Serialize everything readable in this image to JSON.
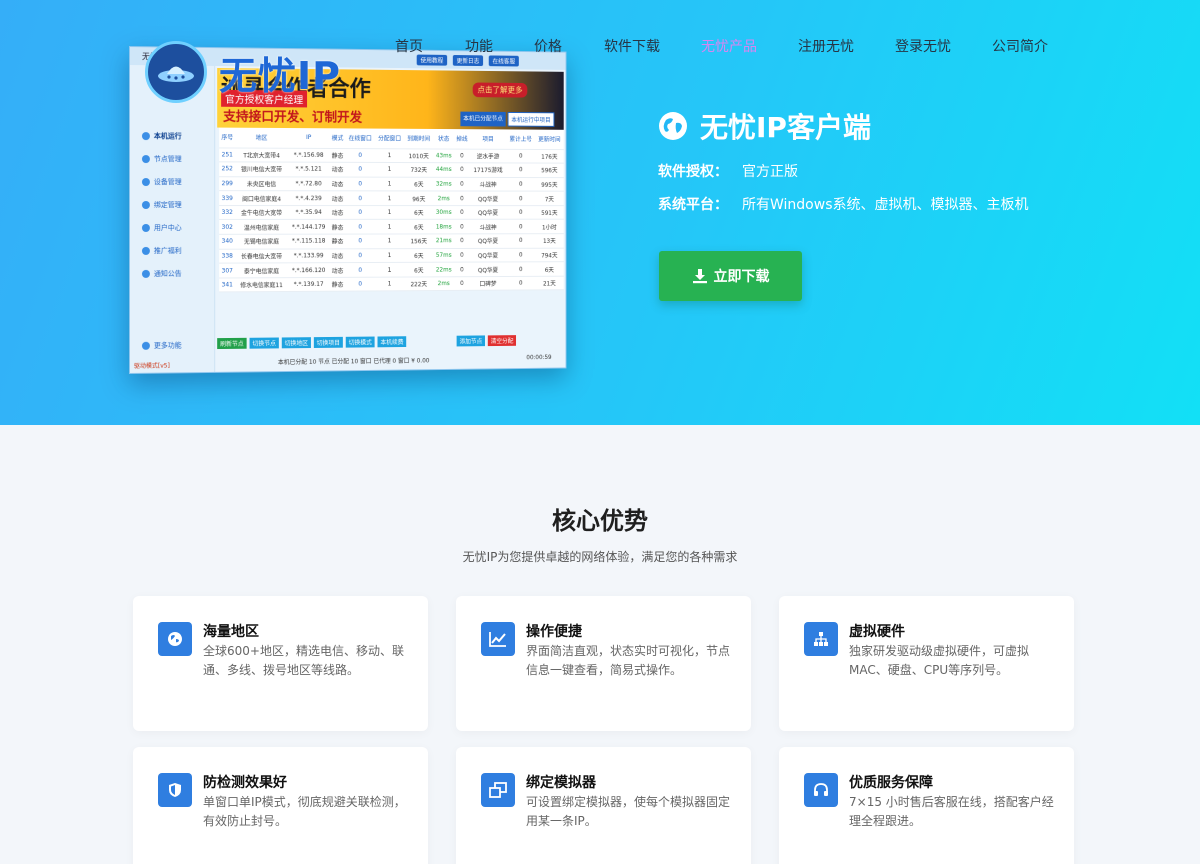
{
  "brand": {
    "logo_text": "无忧IP"
  },
  "nav": [
    {
      "label": "首页"
    },
    {
      "label": "功能"
    },
    {
      "label": "价格"
    },
    {
      "label": "软件下载"
    },
    {
      "label": "无忧产品",
      "active": true
    },
    {
      "label": "注册无忧"
    },
    {
      "label": "登录无忧"
    },
    {
      "label": "公司简介"
    }
  ],
  "app_preview": {
    "window_title": "无忧IP",
    "top_buttons": [
      "使用教程",
      "更新日志",
      "在线客服"
    ],
    "sidebar": [
      "本机运行",
      "节点管理",
      "设备管理",
      "绑定管理",
      "用户中心",
      "推广福利",
      "通知公告"
    ],
    "sidebar_more": "更多功能",
    "mode_text": "驱动模式[v5]",
    "banner_big": "诚寻合作者合作",
    "banner_tag": "官方授权客户经理",
    "banner_sub": "支持接口开发、订制开发",
    "banner_button": "点击了解更多",
    "tabs": [
      "本机已分配节点",
      "本机运行中项目"
    ],
    "columns": [
      "序号",
      "地区",
      "IP",
      "模式",
      "在线窗口",
      "分配窗口",
      "到期时间",
      "状态",
      "掉线",
      "项目",
      "累计上号",
      "更新时间"
    ],
    "rows": [
      [
        "251",
        "T北京大宽带4",
        "*.*.156.98",
        "静态",
        "0",
        "1",
        "1010天",
        "43ms",
        "0",
        "逆水手游",
        "0",
        "176天"
      ],
      [
        "252",
        "银川电信大宽带",
        "*.*.5.121",
        "动态",
        "0",
        "1",
        "732天",
        "44ms",
        "0",
        "17175游戏",
        "0",
        "596天"
      ],
      [
        "299",
        "未央区电信",
        "*.*.72.80",
        "动态",
        "0",
        "1",
        "6天",
        "32ms",
        "0",
        "斗战神",
        "0",
        "995天"
      ],
      [
        "339",
        "闽口电信家庭4",
        "*.*.4.239",
        "动态",
        "0",
        "1",
        "96天",
        "2ms",
        "0",
        "QQ华夏",
        "0",
        "7天"
      ],
      [
        "332",
        "金牛电信大宽带",
        "*.*.35.94",
        "动态",
        "0",
        "1",
        "6天",
        "30ms",
        "0",
        "QQ华夏",
        "0",
        "591天"
      ],
      [
        "302",
        "温州电信家庭",
        "*.*.144.179",
        "静态",
        "0",
        "1",
        "6天",
        "18ms",
        "0",
        "斗战神",
        "0",
        "1小时"
      ],
      [
        "340",
        "无锡电信家庭",
        "*.*.115.118",
        "静态",
        "0",
        "1",
        "156天",
        "21ms",
        "0",
        "QQ华夏",
        "0",
        "13天"
      ],
      [
        "338",
        "长春电信大宽带",
        "*.*.133.99",
        "动态",
        "0",
        "1",
        "6天",
        "57ms",
        "0",
        "QQ华夏",
        "0",
        "794天"
      ],
      [
        "307",
        "泰宁电信家庭",
        "*.*.166.120",
        "动态",
        "0",
        "1",
        "6天",
        "22ms",
        "0",
        "QQ华夏",
        "0",
        "6天"
      ],
      [
        "341",
        "修水电信家庭11",
        "*.*.139.17",
        "静态",
        "0",
        "1",
        "222天",
        "2ms",
        "0",
        "口碑梦",
        "0",
        "21天"
      ]
    ],
    "bottom_buttons": [
      "刷新节点",
      "切换节点",
      "切换地区",
      "切换项目",
      "切换模式",
      "本机续费",
      "添加节点",
      "清空分配"
    ],
    "status_text": "本机已分配 10 节点  已分配 10 窗口  已代理 0 窗口  ¥ 0.00",
    "timer": "00:00:59"
  },
  "hero": {
    "title": "无忧IP客户端",
    "license_label": "软件授权：",
    "license_value": "官方正版",
    "platform_label": "系统平台：",
    "platform_value": "所有Windows系统、虚拟机、模拟器、主板机",
    "download_button": "立即下载"
  },
  "advantages": {
    "title": "核心优势",
    "subtitle": "无忧IP为您提供卓越的网络体验，满足您的各种需求",
    "cards": [
      {
        "icon": "globe-icon",
        "title": "海量地区",
        "desc": "全球600+地区，精选电信、移动、联通、多线、拨号地区等线路。"
      },
      {
        "icon": "chart-icon",
        "title": "操作便捷",
        "desc": "界面简洁直观，状态实时可视化，节点信息一键查看，简易式操作。"
      },
      {
        "icon": "hierarchy-icon",
        "title": "虚拟硬件",
        "desc": "独家研发驱动级虚拟硬件，可虚拟MAC、硬盘、CPU等序列号。"
      },
      {
        "icon": "shield-icon",
        "title": "防检测效果好",
        "desc": "单窗口单IP模式，彻底规避关联检测，有效防止封号。"
      },
      {
        "icon": "windows-icon",
        "title": "绑定模拟器",
        "desc": "可设置绑定模拟器，使每个模拟器固定用某一条IP。"
      },
      {
        "icon": "headset-icon",
        "title": "优质服务保障",
        "desc": "7×15 小时售后客服在线，搭配客户经理全程跟进。"
      }
    ]
  }
}
